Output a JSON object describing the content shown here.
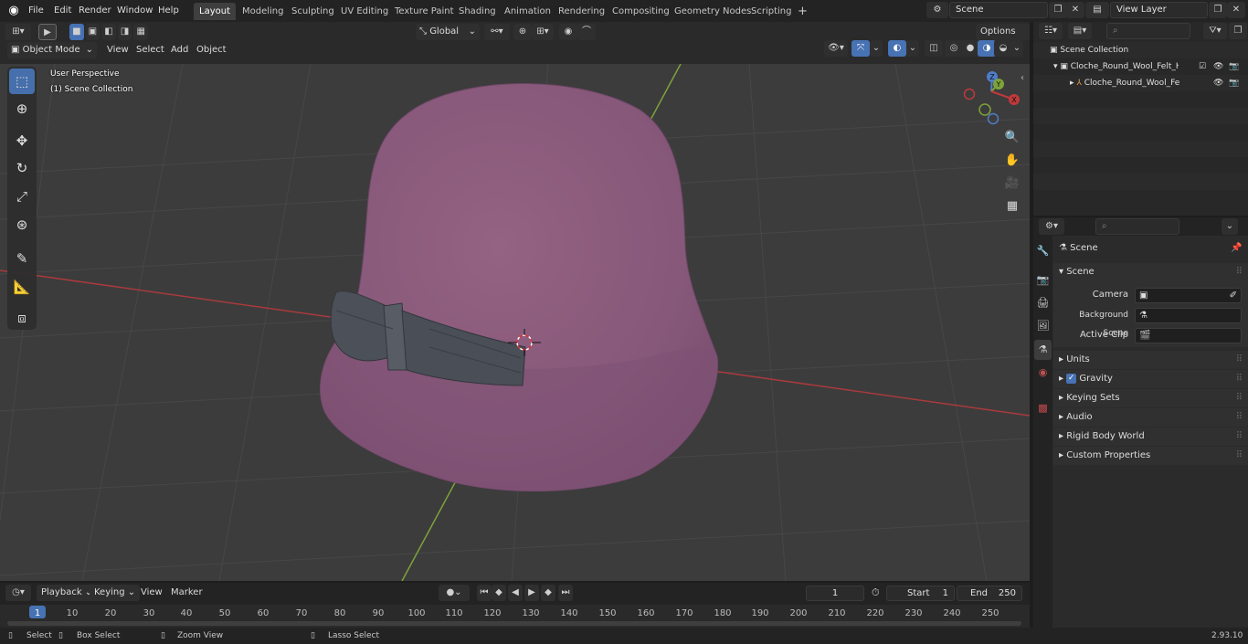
{
  "topbar": {
    "menus": [
      "File",
      "Edit",
      "Render",
      "Window",
      "Help"
    ],
    "workspaces": [
      "Layout",
      "Modeling",
      "Sculpting",
      "UV Editing",
      "Texture Paint",
      "Shading",
      "Animation",
      "Rendering",
      "Compositing",
      "Geometry Nodes",
      "Scripting"
    ],
    "active_workspace": "Layout",
    "scene_name": "Scene",
    "view_layer": "View Layer"
  },
  "viewport_header": {
    "transform_orientation": "Global",
    "options_label": "Options",
    "mode": "Object Mode",
    "menus": [
      "View",
      "Select",
      "Add",
      "Object"
    ]
  },
  "viewport": {
    "perspective_label": "User Perspective",
    "collection_label": "(1) Scene Collection",
    "gizmo_axes": [
      "X",
      "Y",
      "Z"
    ]
  },
  "outliner": {
    "root": "Scene Collection",
    "items": [
      {
        "label": "Cloche_Round_Wool_Felt_Hat"
      },
      {
        "label": "Cloche_Round_Wool_Felt"
      }
    ]
  },
  "properties": {
    "context_title": "Scene",
    "panel_title": "Scene",
    "fields": [
      {
        "label": "Camera",
        "value": ""
      },
      {
        "label": "Background Scene",
        "value": ""
      },
      {
        "label": "Active Clip",
        "value": ""
      }
    ],
    "sections": [
      "Units",
      "Gravity",
      "Keying Sets",
      "Audio",
      "Rigid Body World",
      "Custom Properties"
    ],
    "gravity_checked": true
  },
  "timeline": {
    "menus": [
      "Playback",
      "Keying",
      "View",
      "Marker"
    ],
    "current_frame": "1",
    "start_label": "Start",
    "start_value": "1",
    "end_label": "End",
    "end_value": "250",
    "ruler": [
      "1",
      "10",
      "20",
      "30",
      "40",
      "50",
      "60",
      "70",
      "80",
      "90",
      "100",
      "110",
      "120",
      "130",
      "140",
      "150",
      "160",
      "170",
      "180",
      "190",
      "200",
      "210",
      "220",
      "230",
      "240",
      "250"
    ]
  },
  "statusbar": {
    "hints": [
      "Select",
      "Box Select",
      "Zoom View",
      "Lasso Select"
    ],
    "version": "2.93.10"
  },
  "colors": {
    "accent": "#4772b3",
    "hat": "#8e5c7d",
    "bow": "#4c5058",
    "axis_x": "#c0393b",
    "axis_y": "#7da33a",
    "background": "#3c3c3c"
  }
}
